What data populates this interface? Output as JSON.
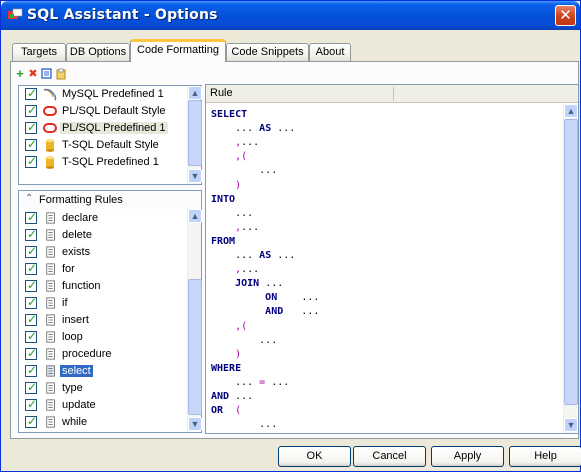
{
  "window": {
    "title": "SQL Assistant - Options",
    "close_glyph": "✕"
  },
  "tabs": [
    {
      "label": "Targets"
    },
    {
      "label": "DB Options"
    },
    {
      "label": "Code Formatting",
      "active": true
    },
    {
      "label": "Code Snippets"
    },
    {
      "label": "About"
    }
  ],
  "toolbar": [
    {
      "icon": "add-icon",
      "glyph": "+",
      "color": "#2aa12a"
    },
    {
      "icon": "delete-icon",
      "glyph": "✖",
      "color": "#e0391b"
    },
    {
      "icon": "copy-icon",
      "glyph": "",
      "color": "#3a6ad4"
    },
    {
      "icon": "paste-icon",
      "glyph": "",
      "color": "#d4a51a"
    }
  ],
  "styles": [
    {
      "label": "MySQL Predefined 1",
      "icon": "dolphin-icon",
      "checked": true
    },
    {
      "label": "PL/SQL Default Style",
      "icon": "oracle-icon",
      "checked": true
    },
    {
      "label": "PL/SQL Predefined 1",
      "icon": "oracle-icon",
      "checked": true,
      "selected": true
    },
    {
      "label": "T-SQL Default Style",
      "icon": "cylinder-icon",
      "checked": true
    },
    {
      "label": "T-SQL Predefined 1",
      "icon": "cylinder-icon",
      "checked": true
    }
  ],
  "rules_header": "Formatting Rules",
  "rules": [
    {
      "label": "declare",
      "checked": true
    },
    {
      "label": "delete",
      "checked": true
    },
    {
      "label": "exists",
      "checked": true
    },
    {
      "label": "for",
      "checked": true
    },
    {
      "label": "function",
      "checked": true
    },
    {
      "label": "if",
      "checked": true
    },
    {
      "label": "insert",
      "checked": true
    },
    {
      "label": "loop",
      "checked": true
    },
    {
      "label": "procedure",
      "checked": true
    },
    {
      "label": "select",
      "checked": true,
      "selected": true
    },
    {
      "label": "type",
      "checked": true
    },
    {
      "label": "update",
      "checked": true
    },
    {
      "label": "while",
      "checked": true
    }
  ],
  "rule_panel": {
    "header": "Rule"
  },
  "code_lines": [
    [
      {
        "t": "SELECT",
        "c": "kw"
      }
    ],
    [
      {
        "t": "    ...",
        "c": ""
      },
      {
        "t": " AS ",
        "c": "kw"
      },
      {
        "t": "...",
        "c": ""
      }
    ],
    [
      {
        "t": "    ,",
        "c": "pu"
      },
      {
        "t": "...",
        "c": ""
      }
    ],
    [
      {
        "t": "    ,(",
        "c": "pu"
      }
    ],
    [
      {
        "t": "        ...",
        "c": ""
      }
    ],
    [
      {
        "t": "    )",
        "c": "pu"
      }
    ],
    [
      {
        "t": "INTO",
        "c": "kw"
      }
    ],
    [
      {
        "t": "    ...",
        "c": ""
      }
    ],
    [
      {
        "t": "    ,",
        "c": "pu"
      },
      {
        "t": "...",
        "c": ""
      }
    ],
    [
      {
        "t": "FROM",
        "c": "kw"
      }
    ],
    [
      {
        "t": "    ...",
        "c": ""
      },
      {
        "t": " AS ",
        "c": "kw"
      },
      {
        "t": "...",
        "c": ""
      }
    ],
    [
      {
        "t": "    ,",
        "c": "pu"
      },
      {
        "t": "...",
        "c": ""
      }
    ],
    [
      {
        "t": "    JOIN ",
        "c": "kw"
      },
      {
        "t": "...",
        "c": ""
      }
    ],
    [
      {
        "t": "         ON",
        "c": "kw"
      },
      {
        "t": "    ...",
        "c": ""
      }
    ],
    [
      {
        "t": "         AND",
        "c": "kw"
      },
      {
        "t": "   ...",
        "c": ""
      }
    ],
    [
      {
        "t": "    ,(",
        "c": "pu"
      }
    ],
    [
      {
        "t": "        ...",
        "c": ""
      }
    ],
    [
      {
        "t": "    )",
        "c": "pu"
      }
    ],
    [
      {
        "t": "WHERE",
        "c": "kw"
      }
    ],
    [
      {
        "t": "    ...",
        "c": ""
      },
      {
        "t": " = ",
        "c": "pu"
      },
      {
        "t": "...",
        "c": ""
      }
    ],
    [
      {
        "t": "AND ",
        "c": "kw"
      },
      {
        "t": "...",
        "c": ""
      }
    ],
    [
      {
        "t": "OR",
        "c": "kw"
      },
      {
        "t": "  (",
        "c": "pu"
      }
    ],
    [
      {
        "t": "        ...",
        "c": ""
      }
    ]
  ],
  "buttons": {
    "ok": "OK",
    "cancel": "Cancel",
    "apply": "Apply",
    "help": "Help"
  }
}
